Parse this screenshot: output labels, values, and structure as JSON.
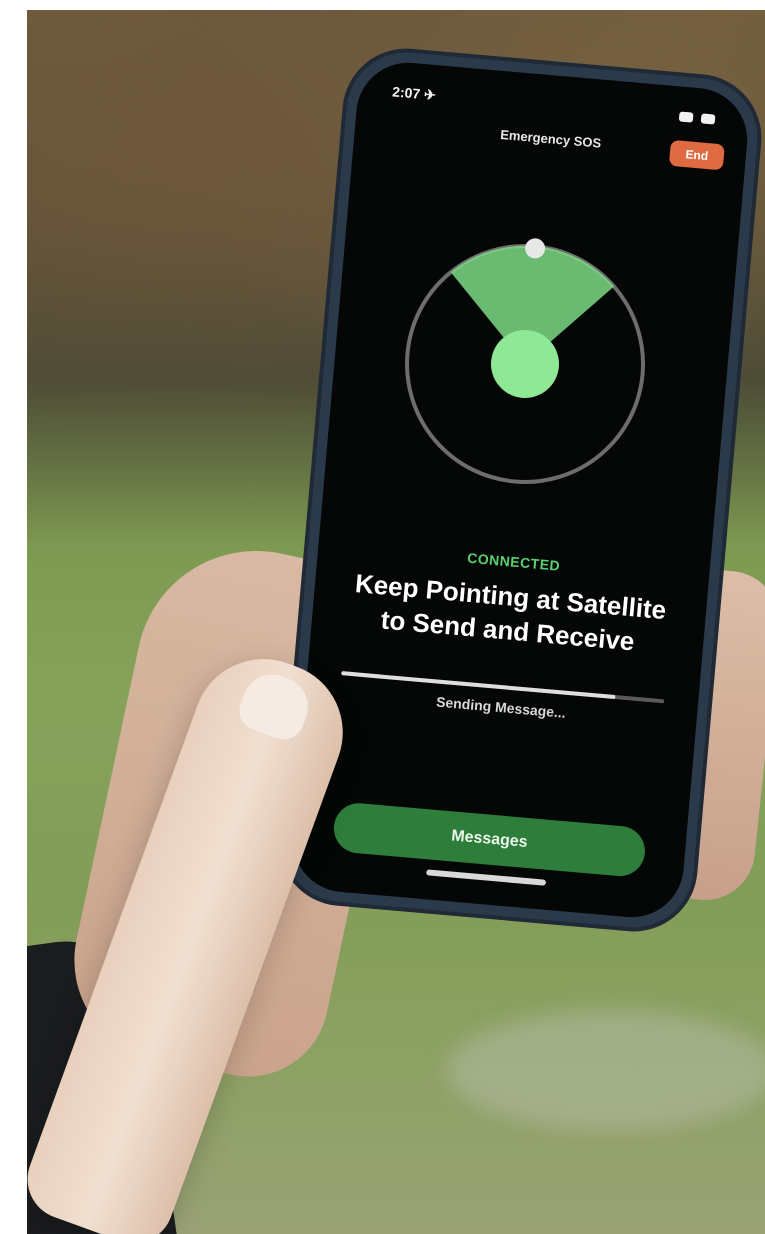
{
  "status_bar": {
    "time": "2:07 ✈"
  },
  "header": {
    "title": "Emergency SOS",
    "end_label": "End"
  },
  "connection": {
    "state": "CONNECTED"
  },
  "instruction": {
    "line1": "Keep Pointing at Satellite",
    "line2": "to Send and Receive"
  },
  "progress": {
    "fraction": 0.85
  },
  "sending": {
    "label": "Sending Message..."
  },
  "actions": {
    "messages_label": "Messages"
  },
  "colors": {
    "accent_green": "#59d26e",
    "end_button": "#e06a42",
    "radar_green": "#7edb86"
  }
}
